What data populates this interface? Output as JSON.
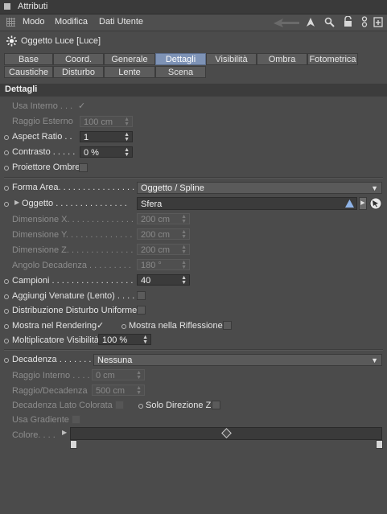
{
  "window": {
    "title": "Attributi"
  },
  "menu": {
    "items": [
      "Modo",
      "Modifica",
      "Dati Utente"
    ]
  },
  "object": {
    "label": "Oggetto Luce [Luce]"
  },
  "tabs": [
    "Base",
    "Coord.",
    "Generale",
    "Dettagli",
    "Visibilità",
    "Ombra",
    "Fotometrica",
    "Caustiche",
    "Disturbo",
    "Lente",
    "Scena"
  ],
  "active_tab": "Dettagli",
  "section": {
    "title": "Dettagli"
  },
  "fields": {
    "usa_interno": {
      "label": "Usa Interno . . .",
      "checked": true
    },
    "raggio_esterno": {
      "label": "Raggio Esterno",
      "value": "100 cm"
    },
    "aspect_ratio": {
      "label": "Aspect Ratio . .",
      "value": "1"
    },
    "contrasto": {
      "label": "Contrasto . . . . .",
      "value": "0 %"
    },
    "proiettore_ombre": {
      "label": "Proiettore Ombre"
    },
    "forma_area": {
      "label": "Forma Area. . . . . . . . . . . . . . . .",
      "value": "Oggetto / Spline"
    },
    "oggetto": {
      "label": "Oggetto . . . . . . . . . . . . . . .",
      "value": "Sfera"
    },
    "dim_x": {
      "label": "Dimensione X. . . . . . . . . . . . . .",
      "value": "200 cm"
    },
    "dim_y": {
      "label": "Dimensione Y. . . . . . . . . . . . . .",
      "value": "200 cm"
    },
    "dim_z": {
      "label": "Dimensione Z. . . . . . . . . . . . . .",
      "value": "200 cm"
    },
    "angolo": {
      "label": "Angolo Decadenza . . . . . . . . .",
      "value": "180 °"
    },
    "campioni": {
      "label": "Campioni . . . . . . . . . . . . . . . . .",
      "value": "40"
    },
    "venature": {
      "label": "Aggiungi Venature (Lento) . . . ."
    },
    "distribuzione": {
      "label": "Distribuzione Disturbo Uniforme"
    },
    "mostra_rendering": {
      "label": "Mostra nel Rendering",
      "checked": true
    },
    "mostra_riflessione": {
      "label": "Mostra nella Riflessione"
    },
    "molt_visibilita": {
      "label": "Moltiplicatore Visibilità",
      "value": "100 %"
    },
    "decadenza": {
      "label": "Decadenza . . . . . . .",
      "value": "Nessuna"
    },
    "raggio_interno": {
      "label": "Raggio Interno . . . .",
      "value": "0 cm"
    },
    "raggio_decadenza": {
      "label": "Raggio/Decadenza",
      "value": "500 cm"
    },
    "decadenza_lato": {
      "label": "Decadenza Lato Colorata"
    },
    "solo_direzione": {
      "label": "Solo Direzione Z"
    },
    "usa_gradiente": {
      "label": "Usa Gradiente"
    },
    "colore": {
      "label": "Colore. . . ."
    }
  },
  "icons": [
    "grid-icon",
    "arrow-left-icon",
    "cursor-icon",
    "search-icon",
    "lock-icon",
    "hierarchy-icon",
    "new-window-icon",
    "light-object-icon",
    "pick-object-icon",
    "target-icon"
  ]
}
